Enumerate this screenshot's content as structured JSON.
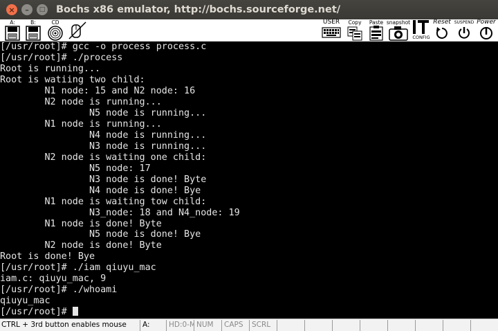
{
  "window": {
    "title": "Bochs x86 emulator, http://bochs.sourceforge.net/",
    "close_glyph": "×",
    "minimize_glyph": "–",
    "maximize_glyph": "□"
  },
  "toolbar": {
    "floppy_a_label": "A:",
    "floppy_b_label": "B:",
    "cdrom_label": "CD",
    "user_label": "USER",
    "copy_label": "Copy",
    "paste_label": "Paste",
    "snapshot_label": "snapshot",
    "config_label": "CONFIG",
    "reset_label": "Reset",
    "suspend_label": "SUSPEND",
    "power_label": "Power"
  },
  "terminal": {
    "lines": [
      "[/usr/root]# gcc -o process process.c",
      "[/usr/root]# ./process",
      "Root is running...",
      "Root is watiing two child:",
      "        N1 node: 15 and N2 node: 16",
      "        N2 node is running...",
      "                N5 node is running...",
      "        N1 node is running...",
      "                N4 node is running...",
      "                N3 node is running...",
      "        N2 node is waiting one child:",
      "                N5 node: 17",
      "                N3 node is done! Byte",
      "                N4 node is done! Bye",
      "        N1 node is waiting tow child:",
      "                N3_node: 18 and N4_node: 19",
      "        N1 node is done! Byte",
      "                N5 node is done! Bye",
      "        N2 node is done! Byte",
      "Root is done! Bye",
      "[/usr/root]# ./iam qiuyu_mac",
      "iam.c: qiuyu_mac, 9",
      "[/usr/root]# ./whoami",
      "qiuyu_mac",
      "[/usr/root]# "
    ]
  },
  "statusbar": {
    "message": "CTRL + 3rd button enables mouse",
    "drive": "A:",
    "hd": "HD:0-M",
    "num": "NUM",
    "caps": "CAPS",
    "scrl": "SCRL"
  },
  "colors": {
    "titlebar": "#3c3b37",
    "close_button": "#f2704a",
    "terminal_bg": "#000000",
    "terminal_fg": "#e6e6e6",
    "statusbar_bg": "#f2f2f2"
  }
}
